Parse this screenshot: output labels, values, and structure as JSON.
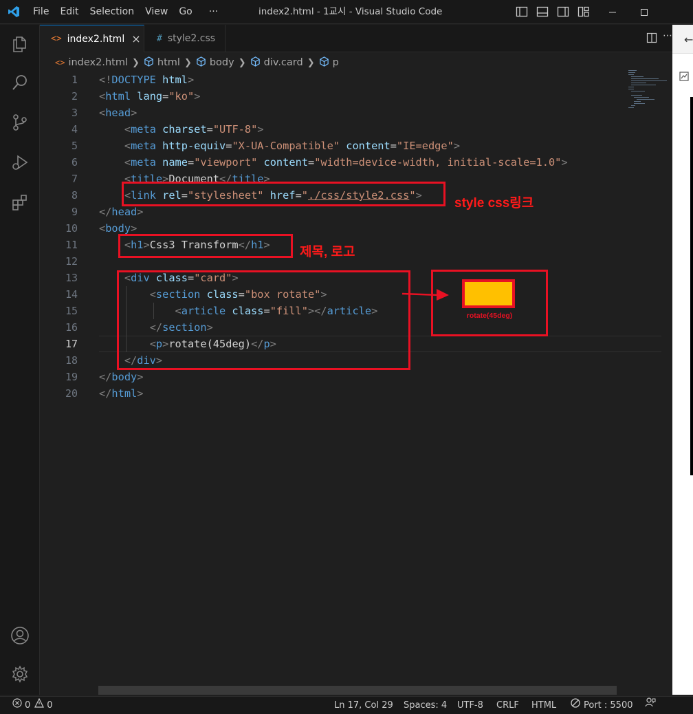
{
  "titlebar": {
    "menu": [
      "File",
      "Edit",
      "Selection",
      "View",
      "Go"
    ],
    "more": "···",
    "title": "index2.html - 1교시 - Visual Studio Code"
  },
  "tabs": [
    {
      "label": "index2.html",
      "icon": "<>",
      "active": true,
      "close": "×"
    },
    {
      "label": "style2.css",
      "icon": "#",
      "active": false
    }
  ],
  "breadcrumb": [
    "index2.html",
    "html",
    "body",
    "div.card",
    "p"
  ],
  "editor": {
    "current_line": 17,
    "lines": [
      "1",
      "2",
      "3",
      "4",
      "5",
      "6",
      "7",
      "8",
      "9",
      "10",
      "11",
      "12",
      "13",
      "14",
      "15",
      "16",
      "17",
      "18",
      "19",
      "20"
    ]
  },
  "annotations": {
    "link_label": "style css링크",
    "title_label": "제목, 로고",
    "preview_caption": "rotate(45deg)",
    "preview_fill_color": "#ffc000",
    "box_color": "#e81123"
  },
  "statusbar": {
    "errors": "0",
    "warnings": "0",
    "position": "Ln 17, Col 29",
    "spaces": "Spaces: 4",
    "encoding": "UTF-8",
    "eol": "CRLF",
    "language": "HTML",
    "port": "Port : 5500"
  },
  "colors": {
    "accent": "#0078d4",
    "tag": "#569cd6",
    "attr": "#9cdcfe",
    "string": "#ce9178"
  }
}
